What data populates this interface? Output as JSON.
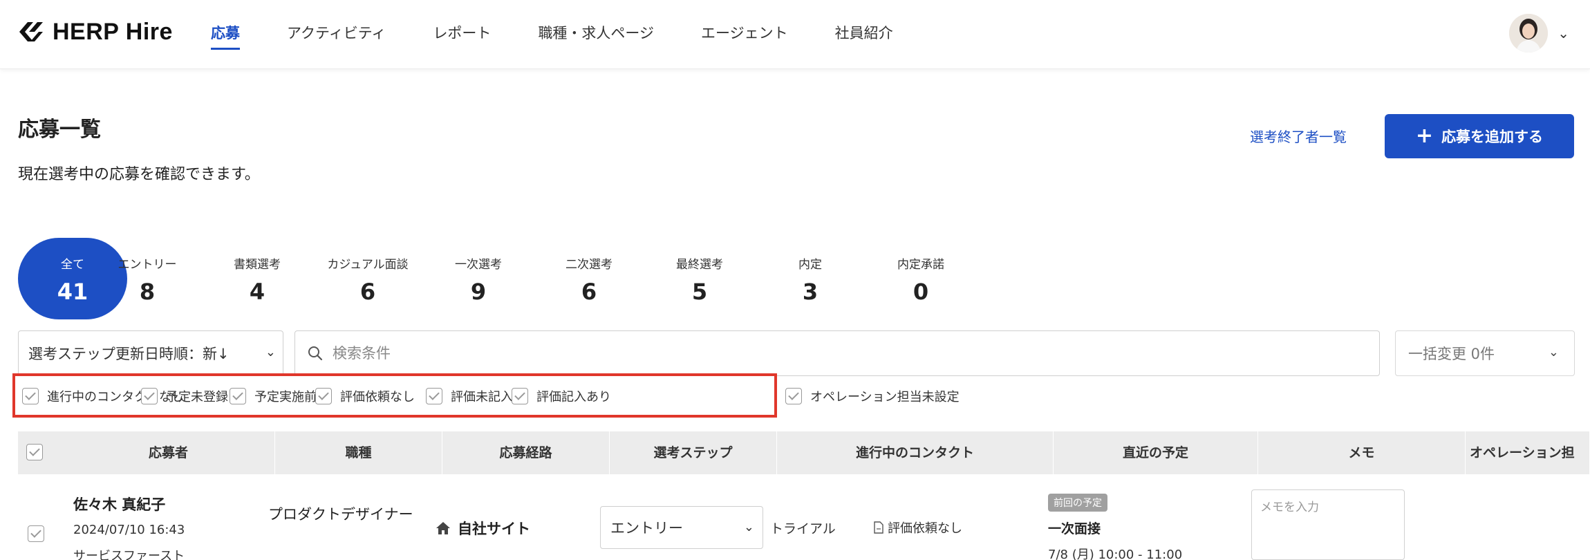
{
  "header": {
    "logo_text": "HERP Hire",
    "nav": [
      {
        "label": "応募",
        "active": true
      },
      {
        "label": "アクティビティ",
        "active": false
      },
      {
        "label": "レポート",
        "active": false
      },
      {
        "label": "職種・求人ページ",
        "active": false
      },
      {
        "label": "エージェント",
        "active": false
      },
      {
        "label": "社員紹介",
        "active": false
      }
    ],
    "user_menu_icon": "chevron-down-icon"
  },
  "page": {
    "title": "応募一覧",
    "description": "現在選考中の応募を確認できます。",
    "finished_link": "選考終了者一覧",
    "add_button": "応募を追加する"
  },
  "stages": [
    {
      "label": "全て",
      "count": "41",
      "active": true
    },
    {
      "label": "エントリー",
      "count": "8"
    },
    {
      "label": "書類選考",
      "count": "4"
    },
    {
      "label": "カジュアル面談",
      "count": "6"
    },
    {
      "label": "一次選考",
      "count": "9"
    },
    {
      "label": "二次選考",
      "count": "6"
    },
    {
      "label": "最終選考",
      "count": "5"
    },
    {
      "label": "内定",
      "count": "3"
    },
    {
      "label": "内定承諾",
      "count": "0"
    }
  ],
  "toolbar": {
    "sort_value": "選考ステップ更新日時順：新↓",
    "search_placeholder": "検索条件",
    "bulk_change": "一括変更 0件"
  },
  "filters": [
    "進行中のコンタクトなし",
    "予定未登録",
    "予定実施前",
    "評価依頼なし",
    "評価未記入",
    "評価記入あり",
    "オペレーション担当未設定"
  ],
  "table": {
    "columns": [
      "応募者",
      "職種",
      "応募経路",
      "選考ステップ",
      "進行中のコンタクト",
      "直近の予定",
      "メモ",
      "オペレーション担"
    ],
    "rows": [
      {
        "name": "佐々木 真紀子",
        "date": "2024/07/10 16:43",
        "company": "サービスファースト",
        "job": "プロダクトデザイナー",
        "route": "自社サイト",
        "step": "エントリー",
        "contact": "トライアル",
        "evaluation": "評価依頼なし",
        "schedule_badge": "前回の予定",
        "schedule_title": "一次面接",
        "schedule_time": "7/8 (月) 10:00 - 11:00",
        "memo_placeholder": "メモを入力"
      }
    ]
  },
  "colors": {
    "accent": "#1d4fc4",
    "highlight": "#e0372b"
  }
}
